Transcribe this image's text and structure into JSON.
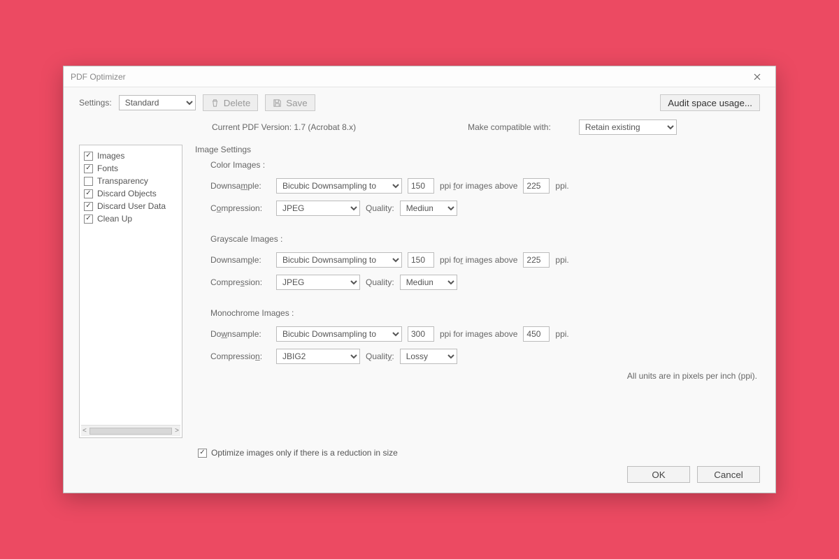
{
  "window": {
    "title": "PDF Optimizer"
  },
  "top": {
    "settings_label": "Settings:",
    "settings_value": "Standard",
    "delete_label": "Delete",
    "save_label": "Save",
    "audit_label": "Audit space usage..."
  },
  "info": {
    "version_text": "Current PDF Version: 1.7 (Acrobat 8.x)",
    "compat_label": "Make compatible with:",
    "compat_value": "Retain existing"
  },
  "sidebar": {
    "items": [
      {
        "label": "Images",
        "checked": true
      },
      {
        "label": "Fonts",
        "checked": true
      },
      {
        "label": "Transparency",
        "checked": false
      },
      {
        "label": "Discard Objects",
        "checked": true
      },
      {
        "label": "Discard User Data",
        "checked": true
      },
      {
        "label": "Clean Up",
        "checked": true
      }
    ]
  },
  "panel": {
    "title": "Image Settings",
    "labels": {
      "downsample": "Downsample:",
      "compression": "Compression:",
      "quality": "Quality:",
      "above": "ppi for images above",
      "ppi": "ppi."
    },
    "color": {
      "heading": "Color Images :",
      "method": "Bicubic Downsampling to",
      "target": "150",
      "threshold": "225",
      "compression": "JPEG",
      "quality": "Medium"
    },
    "gray": {
      "heading": "Grayscale Images :",
      "method": "Bicubic Downsampling to",
      "target": "150",
      "threshold": "225",
      "compression": "JPEG",
      "quality": "Medium"
    },
    "mono": {
      "heading": "Monochrome Images :",
      "method": "Bicubic Downsampling to",
      "target": "300",
      "threshold": "450",
      "compression": "JBIG2",
      "quality": "Lossy"
    },
    "note": "All units are in pixels per inch (ppi).",
    "optimize_only": "Optimize images only if there is a reduction in size",
    "optimize_checked": true
  },
  "footer": {
    "ok": "OK",
    "cancel": "Cancel"
  }
}
